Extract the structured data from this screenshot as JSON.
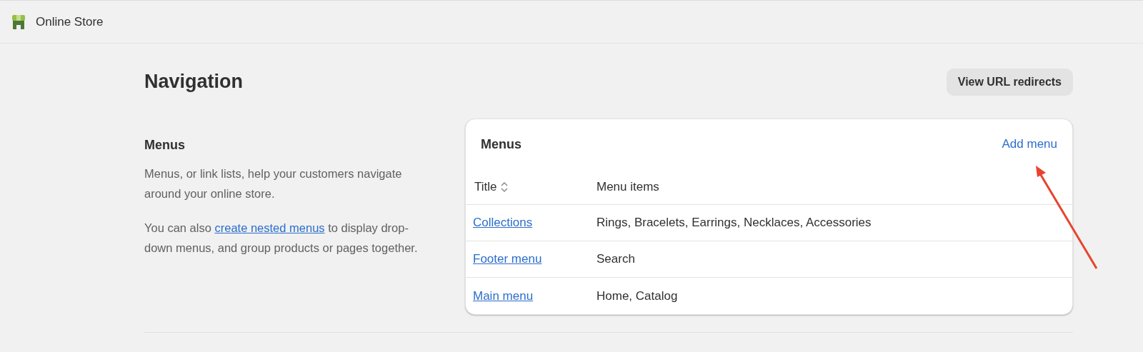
{
  "app_bar": {
    "title": "Online Store"
  },
  "page": {
    "title": "Navigation",
    "action": "View URL redirects"
  },
  "section": {
    "title": "Menus",
    "description": "Menus, or link lists, help your customers navigate around your online store.",
    "note_before": "You can also ",
    "note_link": "create nested menus",
    "note_after": " to display drop-down menus, and group products or pages together."
  },
  "card": {
    "title": "Menus",
    "action": "Add menu",
    "columns": [
      "Title",
      "Menu items"
    ],
    "rows": [
      {
        "title": "Collections",
        "items": "Rings, Bracelets, Earrings, Necklaces, Accessories"
      },
      {
        "title": "Footer menu",
        "items": "Search"
      },
      {
        "title": "Main menu",
        "items": "Home, Catalog"
      }
    ]
  }
}
